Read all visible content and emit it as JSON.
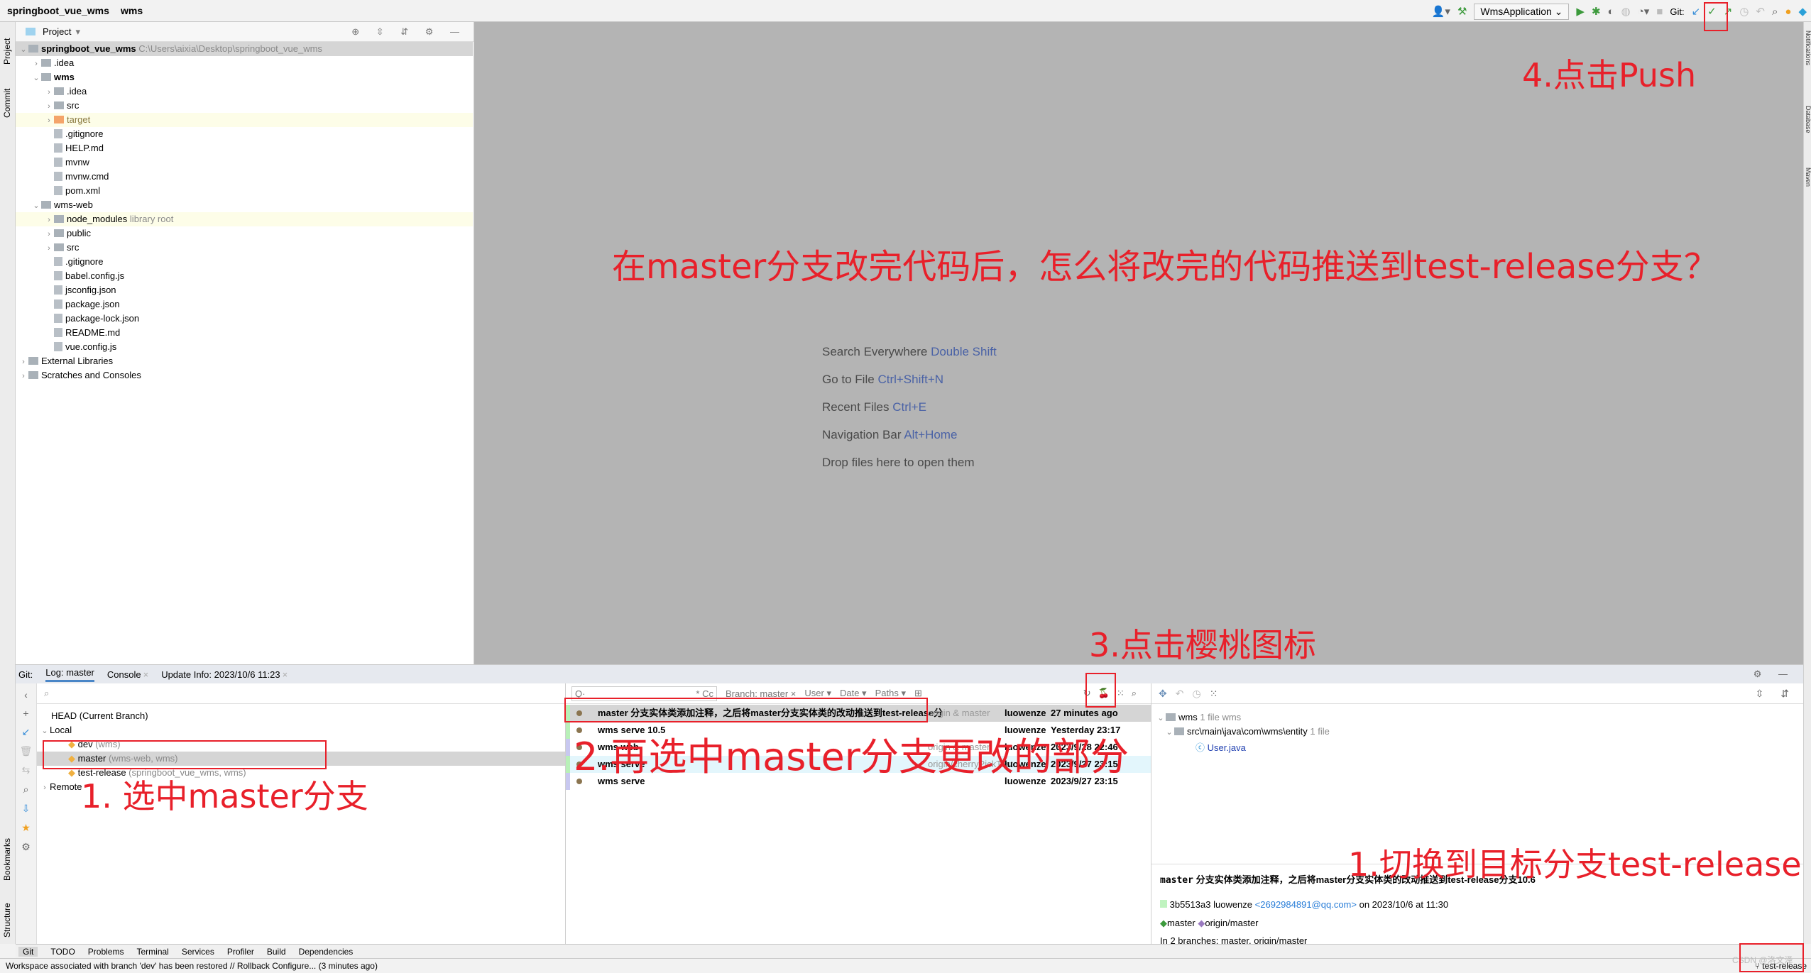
{
  "titlebar": {
    "project": "springboot_vue_wms",
    "module": "wms",
    "run_config": "WmsApplication",
    "git_label": "Git:",
    "icons": [
      "user-icon",
      "build-hammer-icon",
      "run-icon",
      "debug-icon",
      "coverage-icon",
      "profile-icon",
      "run-with-icon",
      "stop-icon",
      "git-update-icon",
      "git-commit-icon",
      "git-push-icon",
      "git-history-icon",
      "git-rollback-icon",
      "search-icon",
      "update-icon",
      "jetbrains-icon"
    ]
  },
  "side_tabs": {
    "left": [
      "Project",
      "Commit",
      "Bookmarks",
      "Structure"
    ],
    "right": [
      "Notifications",
      "Database",
      "Maven"
    ]
  },
  "project": {
    "header": "Project",
    "root": {
      "name": "springboot_vue_wms",
      "path": "C:\\Users\\aixia\\Desktop\\springboot_vue_wms"
    },
    "rows": [
      {
        "depth": 1,
        "arrow": "›",
        "type": "folder",
        "name": ".idea"
      },
      {
        "depth": 1,
        "arrow": "⌄",
        "type": "module",
        "name": "wms",
        "bold": true
      },
      {
        "depth": 2,
        "arrow": "›",
        "type": "folder",
        "name": ".idea"
      },
      {
        "depth": 2,
        "arrow": "›",
        "type": "folder",
        "name": "src"
      },
      {
        "depth": 2,
        "arrow": "›",
        "type": "excluded",
        "name": "target",
        "highlight": true
      },
      {
        "depth": 2,
        "type": "file",
        "name": ".gitignore"
      },
      {
        "depth": 2,
        "type": "file",
        "name": "HELP.md"
      },
      {
        "depth": 2,
        "type": "file",
        "name": "mvnw"
      },
      {
        "depth": 2,
        "type": "file",
        "name": "mvnw.cmd"
      },
      {
        "depth": 2,
        "type": "maven",
        "name": "pom.xml"
      },
      {
        "depth": 1,
        "arrow": "⌄",
        "type": "folder",
        "name": "wms-web"
      },
      {
        "depth": 2,
        "arrow": "›",
        "type": "folder",
        "name": "node_modules",
        "suffix": "library root",
        "highlight": true
      },
      {
        "depth": 2,
        "arrow": "›",
        "type": "folder",
        "name": "public"
      },
      {
        "depth": 2,
        "arrow": "›",
        "type": "folder",
        "name": "src"
      },
      {
        "depth": 2,
        "type": "file",
        "name": ".gitignore"
      },
      {
        "depth": 2,
        "type": "file",
        "name": "babel.config.js"
      },
      {
        "depth": 2,
        "type": "file",
        "name": "jsconfig.json"
      },
      {
        "depth": 2,
        "type": "file",
        "name": "package.json"
      },
      {
        "depth": 2,
        "type": "file",
        "name": "package-lock.json"
      },
      {
        "depth": 2,
        "type": "file",
        "name": "README.md"
      },
      {
        "depth": 2,
        "type": "file",
        "name": "vue.config.js"
      },
      {
        "depth": 0,
        "arrow": "›",
        "type": "libs",
        "name": "External Libraries"
      },
      {
        "depth": 0,
        "arrow": "›",
        "type": "scratch",
        "name": "Scratches and Consoles"
      }
    ]
  },
  "editor": {
    "hints": [
      {
        "text": "Search Everywhere",
        "key": "Double Shift"
      },
      {
        "text": "Go to File",
        "key": "Ctrl+Shift+N"
      },
      {
        "text": "Recent Files",
        "key": "Ctrl+E"
      },
      {
        "text": "Navigation Bar",
        "key": "Alt+Home"
      },
      {
        "text": "Drop files here to open them",
        "key": ""
      }
    ]
  },
  "bottom": {
    "tabs": [
      "Git:",
      "Log: master",
      "Console",
      "Update Info: 2023/10/6 11:23"
    ],
    "branches": {
      "head": "HEAD (Current Branch)",
      "local": "Local",
      "items": [
        {
          "name": "dev",
          "repos": "(wms)"
        },
        {
          "name": "master",
          "repos": "(wms-web, wms)",
          "selected": true
        },
        {
          "name": "test-release",
          "repos": "(springboot_vue_wms, wms)"
        }
      ],
      "remote": "Remote"
    },
    "log": {
      "filters": {
        "search_placeholder": "Q·",
        "regex": "*",
        "case": "Cc",
        "branch": "Branch: master",
        "user": "User",
        "date": "Date",
        "paths": "Paths"
      },
      "commits": [
        {
          "message": "master 分支实体类添加注释，之后将master分支实体类的改动推送到test-release分",
          "refs": "origin & master",
          "author": "luowenze",
          "date": "27 minutes ago",
          "selected": true
        },
        {
          "message": "wms serve 10.5",
          "refs": "",
          "author": "luowenze",
          "date": "Yesterday 23:17"
        },
        {
          "message": "wms web",
          "refs": "origin & master",
          "author": "luowenze",
          "date": "2023/9/28 22:46"
        },
        {
          "message": "wms serve",
          "refs": "origin/cherryPickTest",
          "author": "luowenze",
          "date": "2023/9/27 23:15"
        },
        {
          "message": "wms serve",
          "refs": "",
          "author": "luowenze",
          "date": "2023/9/27 23:15"
        }
      ]
    },
    "changes": {
      "root": "wms",
      "root_count": "1 file",
      "root_suffix": "wms",
      "dir": "src\\main\\java\\com\\wms\\entity",
      "dir_count": "1 file",
      "file": "User.java"
    },
    "details": {
      "message_prefix": "master",
      "message_rest": "分支实体类添加注释，之后将master分支实体类的改动推送到test-release分支10.6",
      "hash": "3b5513a3",
      "author": "luowenze",
      "email": "<2692984891@qq.com>",
      "when": "on 2023/10/6 at 11:30",
      "ref1": "master",
      "ref2": "origin/master",
      "branches": "In 2 branches: master, origin/master"
    }
  },
  "tool_tabs": [
    "Git",
    "TODO",
    "Problems",
    "Terminal",
    "Services",
    "Profiler",
    "Build",
    "Dependencies"
  ],
  "status": {
    "text": "Workspace associated with branch 'dev' has been restored // Rollback   Configure... (3 minutes ago)",
    "branch": "test-release",
    "watermark": "CSDN @洛文泽"
  },
  "annotations": {
    "question": "在master分支改完代码后，怎么将改完的代码推送到test-release分支？",
    "step1": "1. 选中master分支",
    "step2": "2.再选中master分支更改的部分",
    "step3": "3.点击樱桃图标",
    "step4": "4.点击Push",
    "step5": "1.切换到目标分支test-release",
    "color": "#e8202a"
  }
}
